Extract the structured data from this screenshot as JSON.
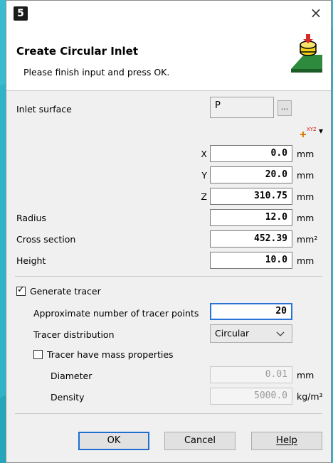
{
  "dialog": {
    "app_icon_text": "5",
    "close_glyph": "×",
    "title": "Create Circular Inlet",
    "subtitle": "Please finish input and press OK."
  },
  "form": {
    "inlet_surface_label": "Inlet surface",
    "inlet_surface_value": "P",
    "browse_label": "...",
    "coord_icon": "xyz-axis-icon",
    "coord_dropdown_glyph": "▾",
    "x_label": "X",
    "x_value": "0.0",
    "x_unit": "mm",
    "y_label": "Y",
    "y_value": "20.0",
    "y_unit": "mm",
    "z_label": "Z",
    "z_value": "310.75",
    "z_unit": "mm",
    "radius_label": "Radius",
    "radius_value": "12.0",
    "radius_unit": "mm",
    "cross_label": "Cross section",
    "cross_value": "452.39",
    "cross_unit": "mm²",
    "height_label": "Height",
    "height_value": "10.0",
    "height_unit": "mm",
    "generate_tracer_label": "Generate tracer",
    "generate_tracer_checked": true,
    "approx_label": "Approximate number of tracer points",
    "approx_value": "20",
    "distribution_label": "Tracer distribution",
    "distribution_value": "Circular",
    "mass_label": "Tracer have mass properties",
    "mass_checked": false,
    "diameter_label": "Diameter",
    "diameter_value": "0.01",
    "diameter_unit": "mm",
    "density_label": "Density",
    "density_value": "5000.0",
    "density_unit": "kg/m³"
  },
  "buttons": {
    "ok": "OK",
    "cancel": "Cancel",
    "help": "Help"
  },
  "colors": {
    "accent": "#2a72d4",
    "background": "#2fb3c8",
    "icon_green": "#2e8b3e",
    "icon_red": "#d62b2b",
    "icon_yellow": "#f2d21a"
  }
}
